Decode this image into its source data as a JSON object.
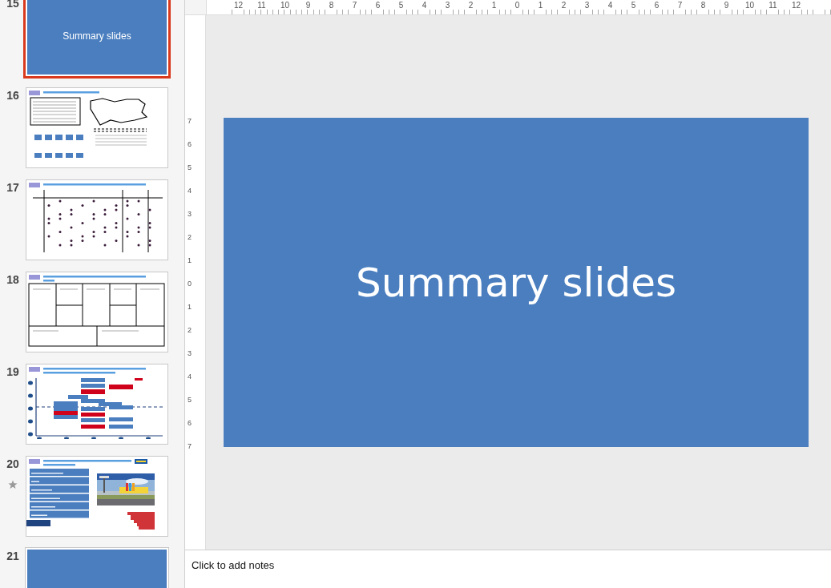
{
  "slides": [
    {
      "number": "15",
      "kind": "section",
      "title": "Summary slides",
      "selected": true,
      "starred": false
    },
    {
      "number": "16",
      "kind": "map",
      "selected": false,
      "starred": false
    },
    {
      "number": "17",
      "kind": "matrix",
      "selected": false,
      "starred": false
    },
    {
      "number": "18",
      "kind": "canvas",
      "selected": false,
      "starred": false
    },
    {
      "number": "19",
      "kind": "roadmap",
      "selected": false,
      "starred": false
    },
    {
      "number": "20",
      "kind": "list",
      "selected": false,
      "starred": true
    },
    {
      "number": "21",
      "kind": "section",
      "selected": false,
      "starred": false
    }
  ],
  "ruler": {
    "horizontal": [
      "12",
      "11",
      "10",
      "9",
      "8",
      "7",
      "6",
      "5",
      "4",
      "3",
      "2",
      "1",
      "0",
      "1",
      "2",
      "3",
      "4",
      "5",
      "6",
      "7",
      "8",
      "9",
      "10",
      "11",
      "12"
    ],
    "vertical": [
      "7",
      "6",
      "5",
      "4",
      "3",
      "2",
      "1",
      "0",
      "1",
      "2",
      "3",
      "4",
      "5",
      "6",
      "7"
    ]
  },
  "current_slide": {
    "title": "Summary slides"
  },
  "notes": {
    "placeholder": "Click to add notes"
  }
}
